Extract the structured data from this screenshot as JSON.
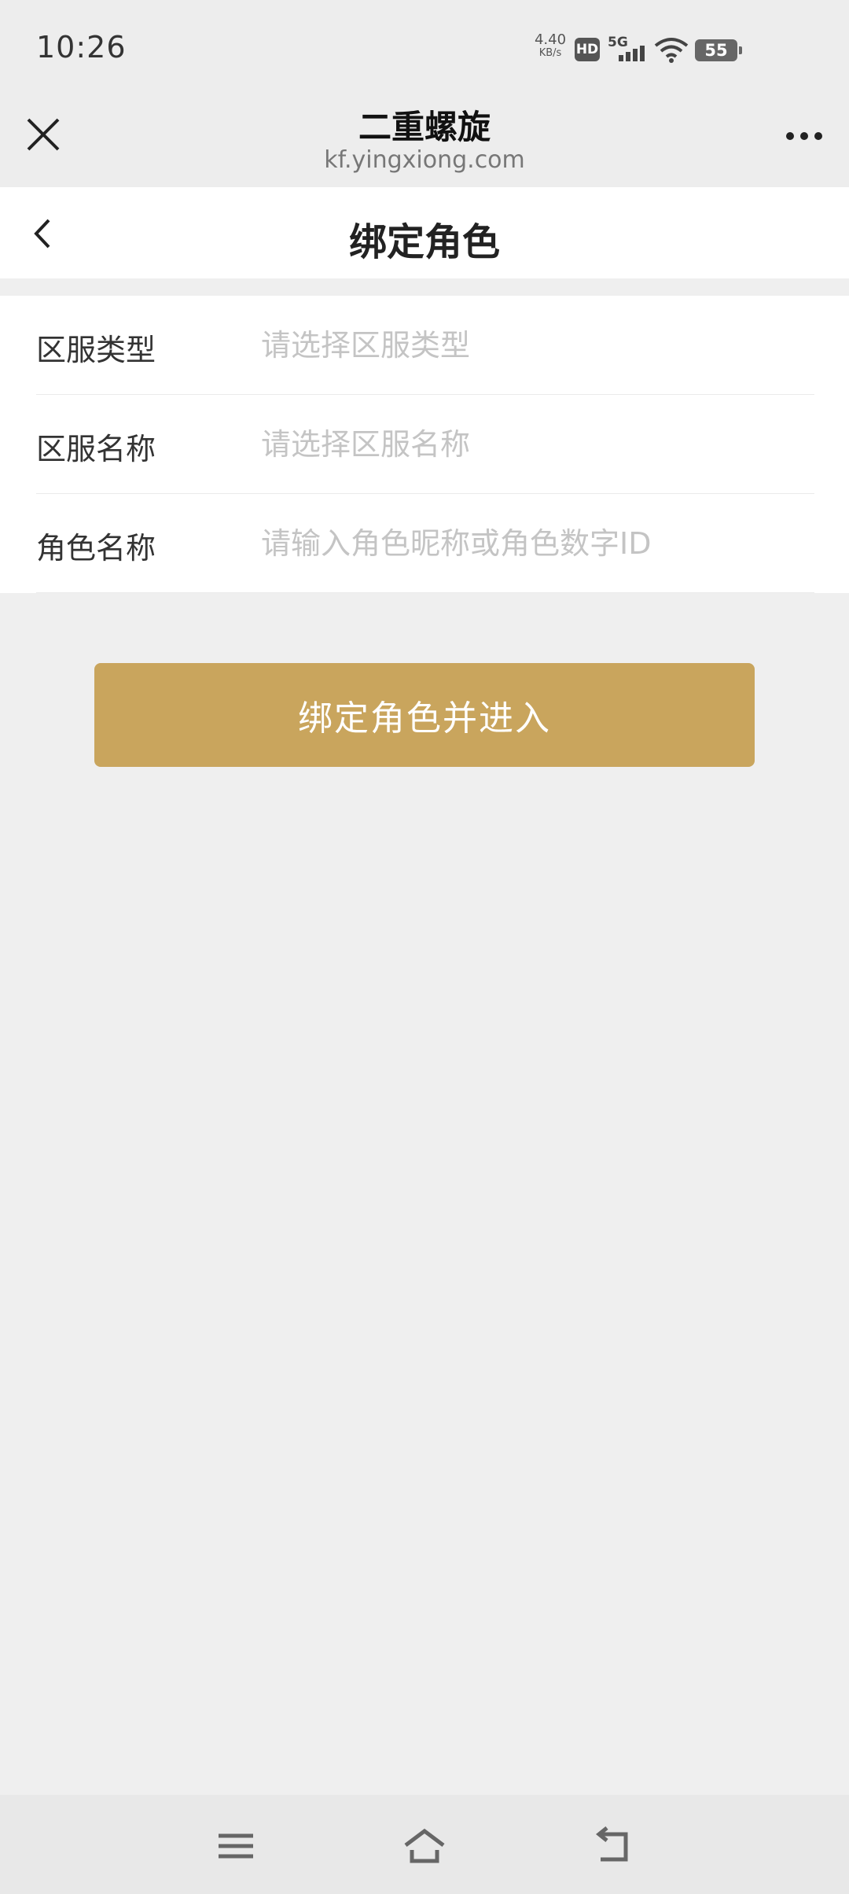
{
  "status_bar": {
    "time": "10:26",
    "net_speed_value": "4.40",
    "net_speed_unit": "KB/s",
    "hd_label": "HD",
    "network_label": "5G",
    "battery_level": "55",
    "icons": [
      "signal-bars-icon",
      "wifi-icon",
      "battery-icon"
    ]
  },
  "browser_bar": {
    "page_heading": "二重螺旋",
    "url": "kf.yingxiong.com",
    "icons": [
      "close-icon",
      "more-icon"
    ]
  },
  "nav_header": {
    "title": "绑定角色",
    "icons": [
      "back-chevron-icon"
    ]
  },
  "form": {
    "rows": [
      {
        "label": "区服类型",
        "value": "",
        "placeholder": "请选择区服类型"
      },
      {
        "label": "区服名称",
        "value": "",
        "placeholder": "请选择区服名称"
      },
      {
        "label": "角色名称",
        "value": "",
        "placeholder": "请输入角色昵称或角色数字ID"
      }
    ],
    "submit_label": "绑定角色并进入"
  },
  "bottom_nav": {
    "icons": [
      "menu-icon",
      "home-icon",
      "back-icon"
    ]
  },
  "colors": {
    "accent": "#c9a55d",
    "background": "#efefef",
    "placeholder": "#c4c4c4"
  }
}
